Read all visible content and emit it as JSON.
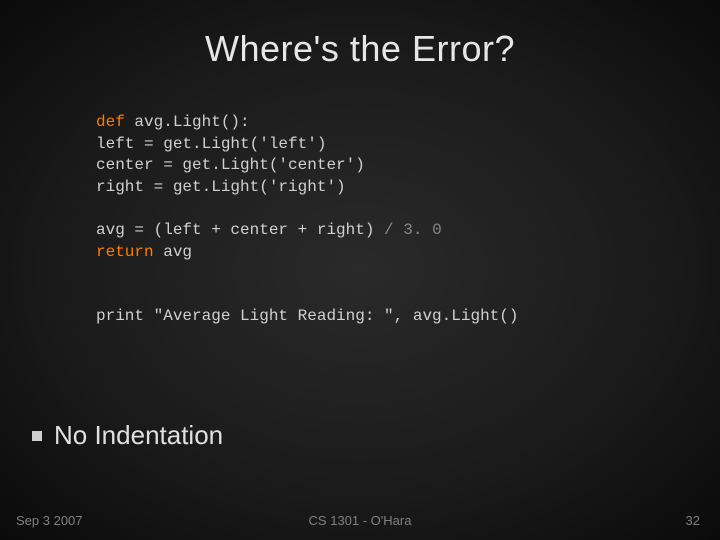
{
  "title": "Where's the Error?",
  "code": {
    "l1a": "def",
    "l1b": " avg.Light():",
    "l2": "left = get.Light('left')",
    "l3": "center = get.Light('center')",
    "l4": "right = get.Light('right')",
    "l5a": "avg = (left + center + right) ",
    "l5op": "/",
    "l5sp": " ",
    "l5num": "3. 0",
    "l6a": "return",
    "l6b": " avg",
    "l7a": "print ",
    "l7b": "\"Average Light Reading: \", avg.Light()"
  },
  "bullet": "No Indentation",
  "footer": {
    "left": "Sep 3 2007",
    "center": "CS 1301 - O'Hara",
    "right": "32"
  }
}
